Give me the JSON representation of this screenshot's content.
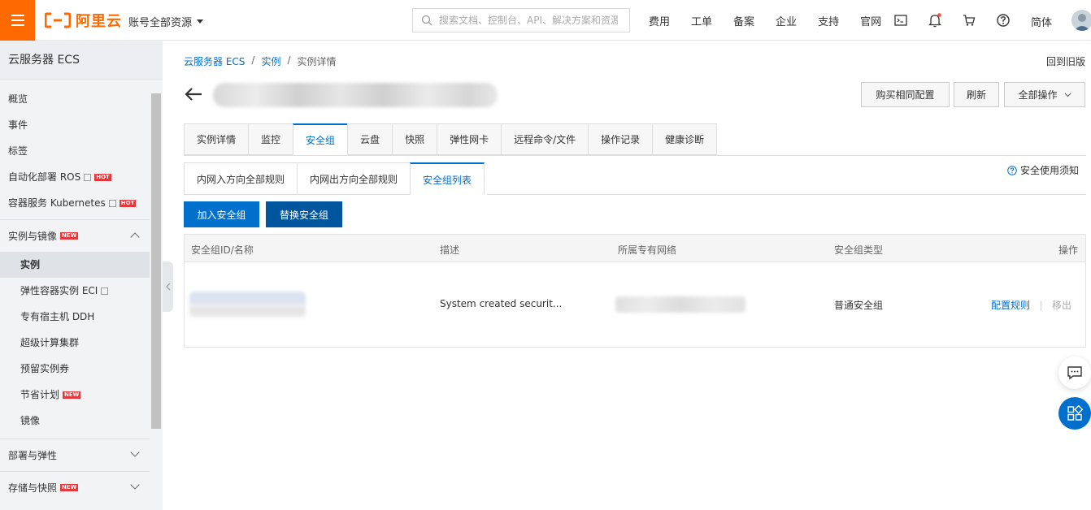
{
  "header": {
    "brand": "阿里云",
    "account_label": "账号全部资源",
    "search_placeholder": "搜索文档、控制台、API、解决方案和资源",
    "nav": [
      "费用",
      "工单",
      "备案",
      "企业",
      "支持",
      "官网"
    ],
    "lang": "简体",
    "brand_color": "#ff6a00"
  },
  "sidebar": {
    "title": "云服务器 ECS",
    "items_top": [
      {
        "label": "概览"
      },
      {
        "label": "事件"
      },
      {
        "label": "标签"
      },
      {
        "label": "自动化部署 ROS",
        "external": true,
        "badge": "HOT"
      },
      {
        "label": "容器服务 Kubernetes",
        "external": true,
        "badge": "HOT"
      }
    ],
    "group_instances": {
      "label": "实例与镜像",
      "badge": "NEW"
    },
    "sub_items": [
      {
        "label": "实例",
        "active": true
      },
      {
        "label": "弹性容器实例 ECI",
        "external": true
      },
      {
        "label": "专有宿主机 DDH"
      },
      {
        "label": "超级计算集群"
      },
      {
        "label": "预留实例券"
      },
      {
        "label": "节省计划",
        "badge": "NEW"
      },
      {
        "label": "镜像"
      }
    ],
    "group_deploy": {
      "label": "部署与弹性"
    },
    "group_storage": {
      "label": "存储与快照",
      "badge": "NEW"
    }
  },
  "breadcrumb": {
    "items": [
      "云服务器 ECS",
      "实例",
      "实例详情"
    ],
    "separator": "/"
  },
  "old_version": "回到旧版",
  "actions": {
    "buy_same": "购买相同配置",
    "refresh": "刷新",
    "all_ops": "全部操作"
  },
  "tabs": [
    "实例详情",
    "监控",
    "安全组",
    "云盘",
    "快照",
    "弹性网卡",
    "远程命令/文件",
    "操作记录",
    "健康诊断"
  ],
  "active_tab": "安全组",
  "subtabs": [
    "内网入方向全部规则",
    "内网出方向全部规则",
    "安全组列表"
  ],
  "active_subtab": "安全组列表",
  "notice": "安全使用须知",
  "buttons": {
    "join": "加入安全组",
    "replace": "替换安全组"
  },
  "table": {
    "columns": [
      "安全组ID/名称",
      "描述",
      "所属专有网络",
      "安全组类型",
      "操作"
    ],
    "row": {
      "description": "System created securit...",
      "type": "普通安全组",
      "action_config": "配置规则",
      "action_remove": "移出"
    }
  },
  "accent_color": "#0070cc"
}
